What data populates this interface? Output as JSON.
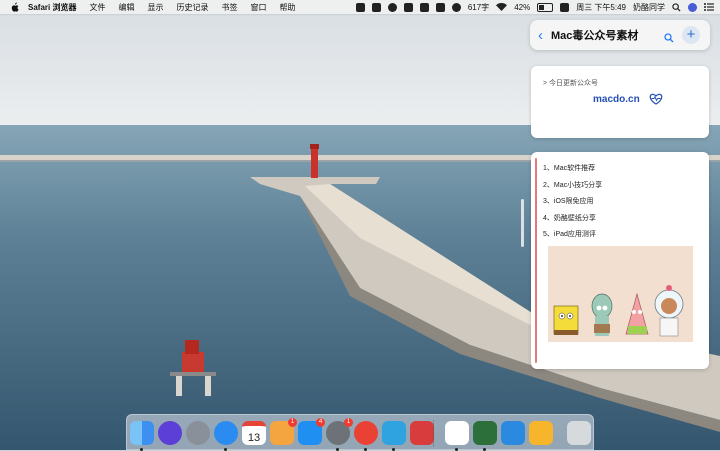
{
  "menubar": {
    "app_name": "Safari 浏览器",
    "menus": [
      "文件",
      "编辑",
      "显示",
      "历史记录",
      "书签",
      "窗口",
      "帮助"
    ],
    "status": {
      "speed": "617字",
      "battery": "42%",
      "datetime": "周三 下午5:49",
      "user": "奶酪同学"
    }
  },
  "notification_center": {
    "title": "Mac毒公众号素材",
    "card1": {
      "label": "> 今日更新公众号",
      "brand": "macdo.cn"
    },
    "card2": {
      "items": [
        "1、Mac软件推荐",
        "2、Mac小技巧分享",
        "3、iOS限免应用",
        "4、奶酪壁纸分享",
        "5、iPad应用测评"
      ]
    }
  },
  "dock": {
    "apps": [
      {
        "name": "finder-icon",
        "color": "#3d8ff0",
        "running": true
      },
      {
        "name": "siri-icon",
        "color": "#5b3fd6",
        "running": false
      },
      {
        "name": "launchpad-icon",
        "color": "#8a9099",
        "running": false
      },
      {
        "name": "safari-icon",
        "color": "#2a8cf0",
        "running": true
      },
      {
        "name": "calendar-icon",
        "color": "#ffffff",
        "running": false
      },
      {
        "name": "photos-icon",
        "color": "#f4a540",
        "running": false,
        "badge": "1"
      },
      {
        "name": "app-store-icon",
        "color": "#1f8ff2",
        "running": false,
        "badge": "4"
      },
      {
        "name": "system-preferences-icon",
        "color": "#6d7279",
        "running": true,
        "badge": "1"
      },
      {
        "name": "chrome-icon",
        "color": "#e94235",
        "running": true
      },
      {
        "name": "telegram-icon",
        "color": "#2fa3e0",
        "running": true
      },
      {
        "name": "reeder-icon",
        "color": "#d83c3c",
        "running": false
      },
      {
        "name": "baidu-netdisk-icon",
        "color": "#ffffff",
        "running": true
      },
      {
        "name": "image-viewer-icon",
        "color": "#2c6f3a",
        "running": true
      },
      {
        "name": "xcode-icon",
        "color": "#2b8ae0",
        "running": false
      },
      {
        "name": "sketch-icon",
        "color": "#f7b52b",
        "running": false
      },
      {
        "name": "trash-icon",
        "color": "#d6dadd",
        "running": false
      }
    ],
    "calendar_day": "13"
  }
}
